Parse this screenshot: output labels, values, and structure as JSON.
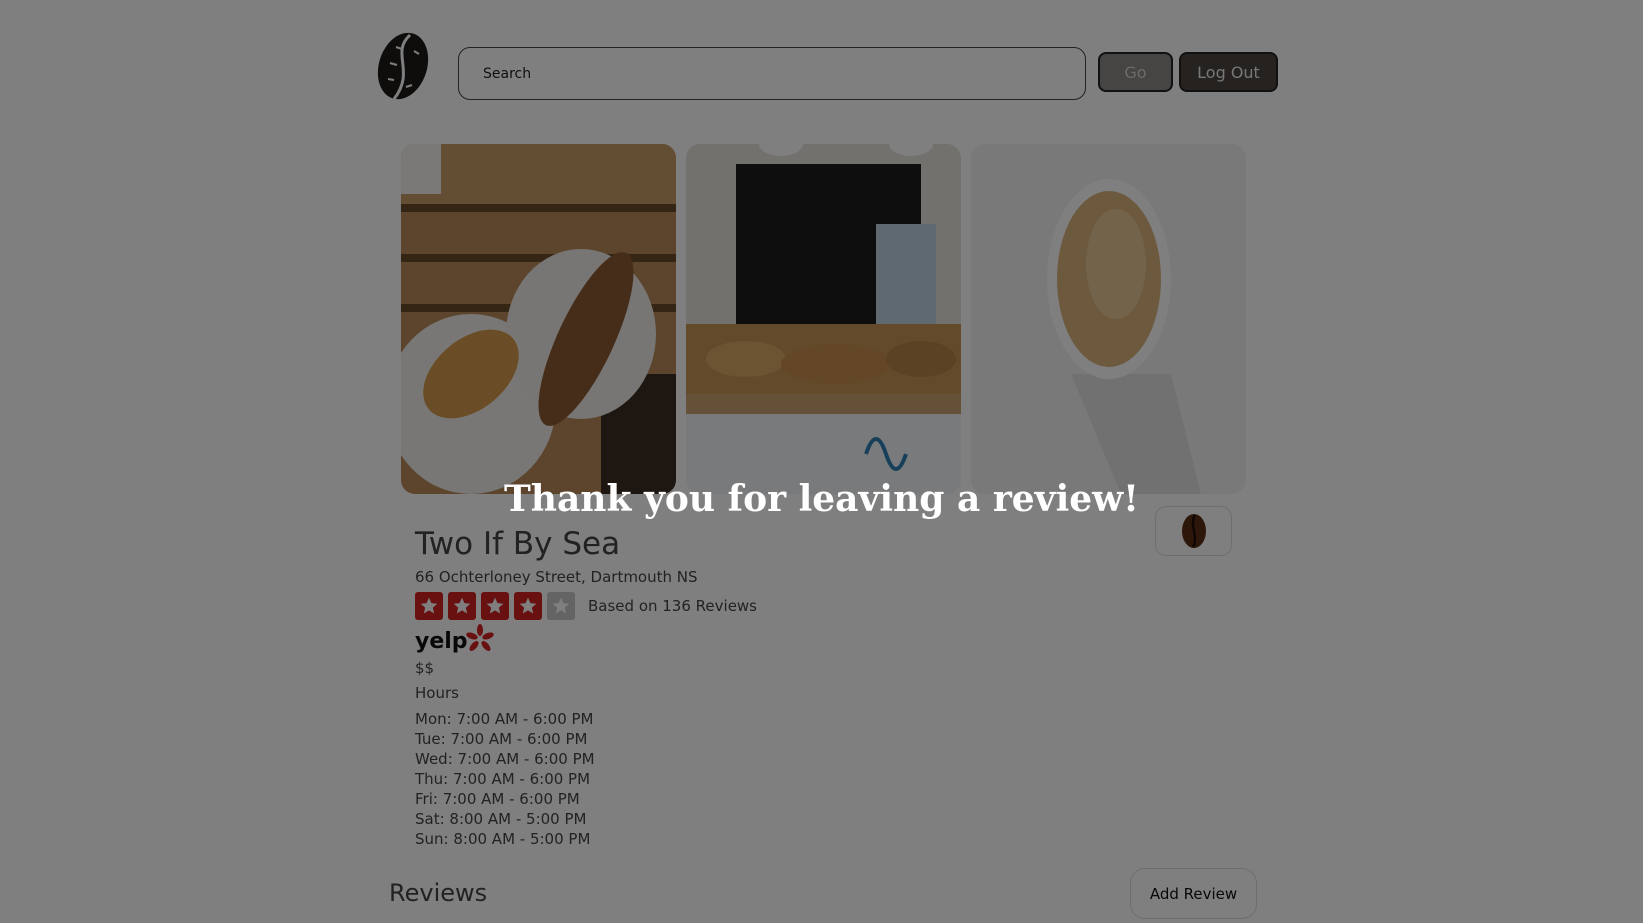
{
  "header": {
    "logo_icon": "coffee-bean-logo-icon",
    "search_placeholder": "Search",
    "go_label": "Go",
    "logout_label": "Log Out"
  },
  "photos": [
    {
      "subject": "croissants on plates"
    },
    {
      "subject": "bakery counter"
    },
    {
      "subject": "latte cup"
    }
  ],
  "business": {
    "name": "Two If By Sea",
    "address": "66 Ochterloney Street, Dartmouth NS",
    "rating": 4,
    "rating_max": 5,
    "review_count_text": "Based on 136 Reviews",
    "source_logo_text": "yelp",
    "price": "$$",
    "hours_title": "Hours",
    "hours": [
      "Mon: 7:00 AM - 6:00 PM",
      "Tue: 7:00 AM - 6:00 PM",
      "Wed: 7:00 AM - 6:00 PM",
      "Thu: 7:00 AM - 6:00 PM",
      "Fri: 7:00 AM - 6:00 PM",
      "Sat: 8:00 AM - 5:00 PM",
      "Sun: 8:00 AM - 5:00 PM"
    ],
    "favorite_icon": "coffee-bean-icon"
  },
  "reviews": {
    "title": "Reviews",
    "add_label": "Add Review"
  },
  "toast": {
    "message": "Thank you for leaving a review!"
  },
  "colors": {
    "star_filled": "#d32323",
    "star_empty": "#c8c8c8",
    "overlay": "rgba(0,0,0,0.5)"
  }
}
